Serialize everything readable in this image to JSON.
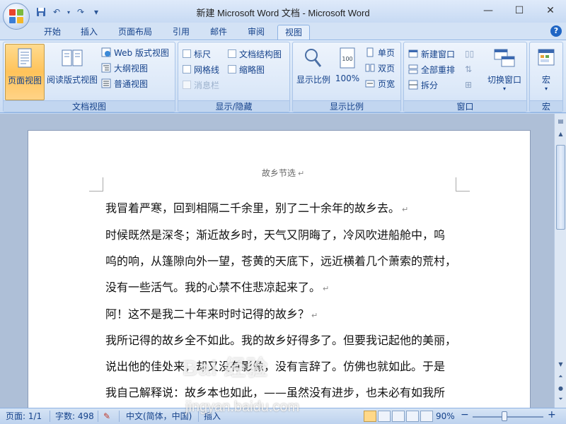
{
  "window": {
    "title": "新建 Microsoft Word 文档 - Microsoft Word",
    "minimize": "—",
    "restore": "☐",
    "close": "✕"
  },
  "qat": {
    "save": "💾",
    "undo": "↶",
    "redo": "↷",
    "customize": "▾"
  },
  "tabs": [
    "开始",
    "插入",
    "页面布局",
    "引用",
    "邮件",
    "审阅",
    "视图"
  ],
  "active_tab": "视图",
  "help": "?",
  "ribbon": {
    "doc_views": {
      "label": "文档视图",
      "page_view": "页面视图",
      "reading_view": "阅读版式视图",
      "web_view": "Web 版式视图",
      "outline_view": "大纲视图",
      "draft_view": "普通视图"
    },
    "show_hide": {
      "label": "显示/隐藏",
      "ruler": "标尺",
      "gridlines": "网格线",
      "message_bar": "消息栏",
      "doc_map": "文档结构图",
      "thumbnails": "缩略图"
    },
    "zoom": {
      "label": "显示比例",
      "zoom": "显示比例",
      "hundred": "100%",
      "one_page": "单页",
      "two_pages": "双页",
      "page_width": "页宽"
    },
    "window": {
      "label": "窗口",
      "new_window": "新建窗口",
      "arrange_all": "全部重排",
      "split": "拆分",
      "switch_windows": "切换窗口"
    },
    "macros": {
      "label": "宏",
      "macros": "宏"
    }
  },
  "document": {
    "header": "故乡节选",
    "lines": [
      "我冒着严寒，回到相隔二千余里，别了二十余年的故乡去。",
      "时候既然是深冬；渐近故乡时，天气又阴晦了，冷风吹进船舱中，呜",
      "呜的响，从篷隙向外一望，苍黄的天底下，远近横着几个萧索的荒村，",
      "没有一些活气。我的心禁不住悲凉起来了。",
      "阿！这不是我二十年来时时记得的故乡？",
      "我所记得的故乡全不如此。我的故乡好得多了。但要我记起他的美丽，",
      "说出他的佳处来，却又没有影像，没有言辞了。仿佛也就如此。于是",
      "我自己解释说：故乡本也如此，——虽然没有进步，也未必有如我所"
    ],
    "para_mark": "↵"
  },
  "statusbar": {
    "page": "页面: 1/1",
    "words": "字数: 498",
    "language": "中文(简体，中国)",
    "insert": "插入",
    "zoom": "90%",
    "zoom_minus": "−",
    "zoom_plus": "+",
    "zoom_fraction": 0.45
  },
  "watermark": {
    "brand": "Bai 经验",
    "url": "jingyan.baidu.com"
  },
  "colors": {
    "accent": "#15428b",
    "ribbon_bg": "#dae7f8",
    "pressed": "#ffc35a"
  }
}
